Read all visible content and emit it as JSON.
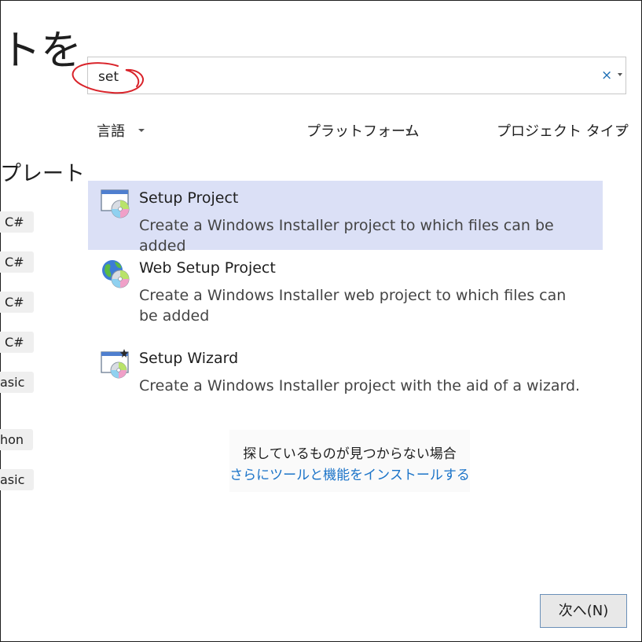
{
  "header": {
    "title_fragment": "トを"
  },
  "search": {
    "value": "set",
    "clear_symbol": "×"
  },
  "filters": [
    {
      "label": "言語"
    },
    {
      "label": "プラットフォーム"
    },
    {
      "label": "プロジェクト タイプ"
    }
  ],
  "recent": {
    "heading": "プレート",
    "tags": [
      "C#",
      "C#",
      "C#",
      "C#",
      "asic",
      "hon",
      "asic"
    ]
  },
  "results": [
    {
      "title": "Setup Project",
      "description": "Create a Windows Installer project to which files can be added",
      "icon": "setup-project-icon",
      "selected": true
    },
    {
      "title": "Web Setup Project",
      "description": "Create a Windows Installer web project to which files can be added",
      "icon": "web-setup-project-icon",
      "selected": false
    },
    {
      "title": "Setup Wizard",
      "description": "Create a Windows Installer project with the aid of a wizard.",
      "icon": "setup-wizard-icon",
      "selected": false
    }
  ],
  "help": {
    "text": "探しているものが見つからない場合",
    "link": "さらにツールと機能をインストールする"
  },
  "footer": {
    "next_label": "次へ(N)"
  },
  "colors": {
    "accent": "#1a73c8",
    "selected_row": "#dbe0f6",
    "annotation": "#d9232a"
  }
}
